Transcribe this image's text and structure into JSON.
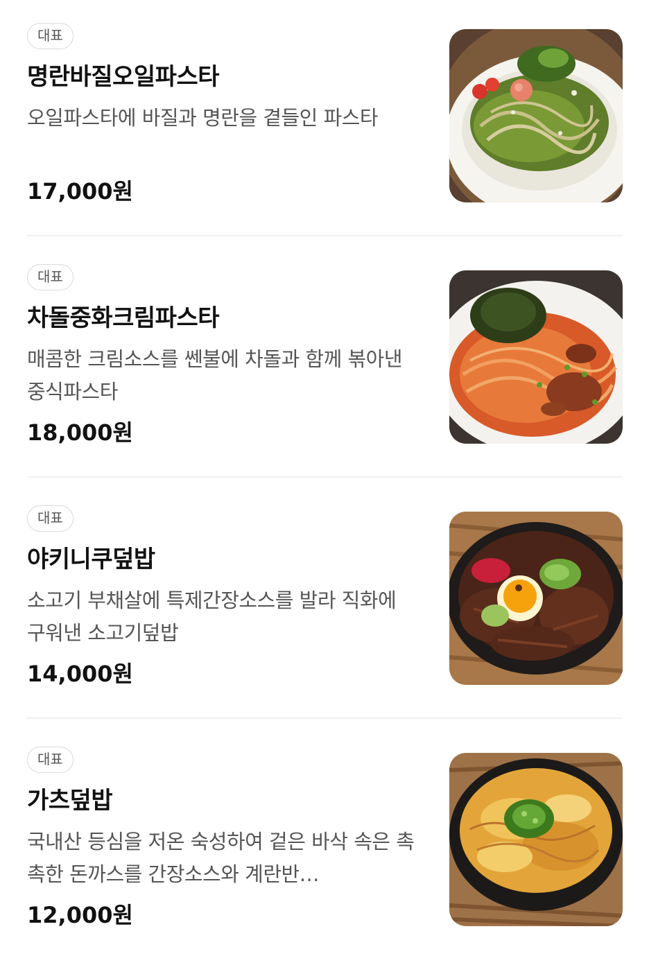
{
  "menu": {
    "items": [
      {
        "badge": "대표",
        "name": "명란바질오일파스타",
        "description": "오일파스타에 바질과 명란을 곁들인 파스타",
        "price": "17,000원",
        "image": "basil-pollock-roe-oil-pasta-photo"
      },
      {
        "badge": "대표",
        "name": "차돌중화크림파스타",
        "description": "매콤한 크림소스를 쎈불에 차돌과 함께 볶아낸 중식파스타",
        "price": "18,000원",
        "image": "brisket-chinese-cream-pasta-photo"
      },
      {
        "badge": "대표",
        "name": "야키니쿠덮밥",
        "description": "소고기 부채살에 특제간장소스를 발라 직화에 구워낸 소고기덮밥",
        "price": "14,000원",
        "image": "yakiniku-rice-bowl-photo"
      },
      {
        "badge": "대표",
        "name": "가츠덮밥",
        "description": "국내산 등심을 저온 숙성하여 겉은 바삭 속은 촉촉한 돈까스를 간장소스와 계란반…",
        "price": "12,000원",
        "image": "katsu-rice-bowl-photo"
      }
    ]
  },
  "colors": {
    "text_primary": "#111111",
    "text_secondary": "#555555",
    "badge_border": "#d9d9d9",
    "divider": "#f0f0f0"
  }
}
